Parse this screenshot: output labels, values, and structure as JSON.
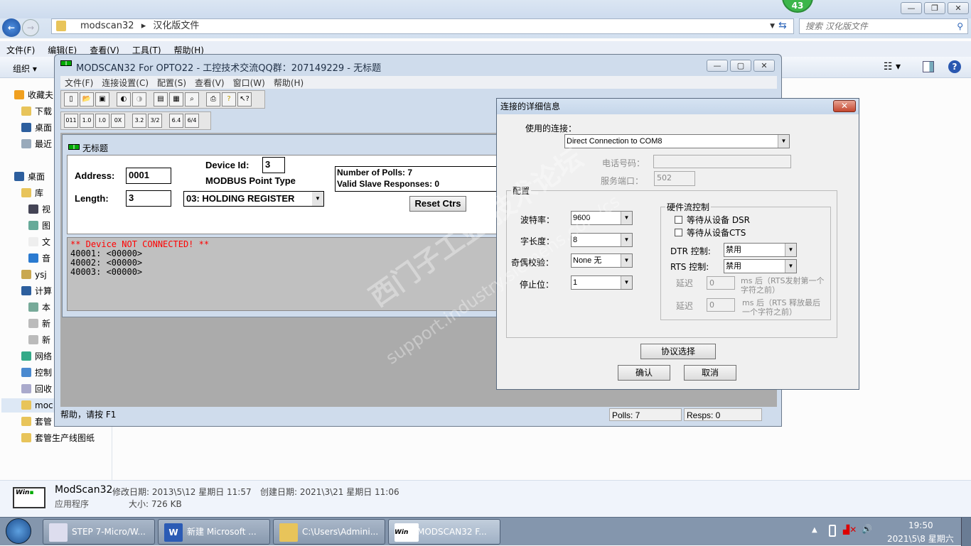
{
  "explorer": {
    "badge": "43",
    "breadcrumb": [
      "modscan32",
      "汉化版文件"
    ],
    "search_placeholder": "搜索 汉化版文件",
    "menu": [
      "文件(F)",
      "编辑(E)",
      "查看(V)",
      "工具(T)",
      "帮助(H)"
    ],
    "organize": "组织 ▾",
    "sidebar": [
      {
        "label": "收藏夫",
        "icon": "star-icon"
      },
      {
        "label": "下载",
        "icon": "download-folder-icon"
      },
      {
        "label": "桌面",
        "icon": "desktop-icon"
      },
      {
        "label": "最近",
        "icon": "recent-icon"
      },
      {
        "label": "桌面",
        "icon": "desktop-icon"
      },
      {
        "label": "库",
        "icon": "library-icon"
      },
      {
        "label": "视",
        "icon": "video-icon"
      },
      {
        "label": "图",
        "icon": "picture-icon"
      },
      {
        "label": "文",
        "icon": "document-icon"
      },
      {
        "label": "音",
        "icon": "music-icon"
      },
      {
        "label": "ysj",
        "icon": "user-folder-icon"
      },
      {
        "label": "计算",
        "icon": "computer-icon"
      },
      {
        "label": "本",
        "icon": "local-disk-icon"
      },
      {
        "label": "新",
        "icon": "drive-icon"
      },
      {
        "label": "新",
        "icon": "drive-icon"
      },
      {
        "label": "网络",
        "icon": "network-icon"
      },
      {
        "label": "控制",
        "icon": "control-panel-icon"
      },
      {
        "label": "回收",
        "icon": "recycle-bin-icon"
      },
      {
        "label": "moc",
        "icon": "folder-icon"
      },
      {
        "label": "套管",
        "icon": "folder-icon"
      },
      {
        "label": "套管生产线图纸",
        "icon": "folder-icon"
      }
    ],
    "details": {
      "name": "ModScan32",
      "modified": "修改日期: 2013\\5\\12 星期日 11:57",
      "created": "创建日期: 2021\\3\\21 星期日 11:06",
      "type": "应用程序",
      "size": "大小: 726 KB"
    }
  },
  "modscan": {
    "title": "MODSCAN32 For OPTO22 - 工控技术交流QQ群：207149229 - 无标题",
    "menu": [
      "文件(F)",
      "连接设置(C)",
      "配置(S)",
      "查看(V)",
      "窗口(W)",
      "帮助(H)"
    ],
    "toolbar2": [
      "011",
      "1.0",
      "I.0",
      "0X",
      "3.2",
      "3/2",
      "6.4",
      "6/4"
    ],
    "child_title": "无标题",
    "address_label": "Address:",
    "address": "0001",
    "device_id_label": "Device Id:",
    "device_id": "3",
    "point_type_label": "MODBUS Point Type",
    "length_label": "Length:",
    "length": "3",
    "point_type": "03: HOLDING REGISTER",
    "polls_text": "Number of Polls: 7",
    "responses_text": "Valid Slave Responses: 0",
    "reset_button": "Reset Ctrs",
    "output": {
      "error": "** Device NOT CONNECTED! **",
      "lines": [
        "40001: <00000>",
        "40002: <00000>",
        "40003: <00000>"
      ]
    },
    "status": {
      "help": "帮助，请按 F1",
      "polls": "Polls: 7",
      "resps": "Resps: 0"
    }
  },
  "dialog": {
    "title": "连接的详细信息",
    "connection_label": "使用的连接：",
    "connection": "Direct Connection to COM8",
    "phone_label": "电话号码：",
    "phone": "",
    "port_label": "服务端口：",
    "port": "502",
    "config_group": "配置",
    "baud_label": "波特率：",
    "baud": "9600",
    "wordlen_label": "字长度：",
    "wordlen": "8",
    "parity_label": "奇偶校验：",
    "parity": "None 无",
    "stopbits_label": "停止位：",
    "stopbits": "1",
    "flow_group": "硬件流控制",
    "dsr_label": "等待从设备 DSR",
    "dsr_checked": false,
    "cts_label": "等待从设备CTS",
    "cts_checked": false,
    "dtr_label": "DTR 控制:",
    "dtr": "禁用",
    "rts_label": "RTS 控制:",
    "rts": "禁用",
    "delay1_label": "延迟",
    "delay1": "0",
    "delay1_note": "ms 后（RTS发射第一个字符之前）",
    "delay2_label": "延迟",
    "delay2": "0",
    "delay2_note": "ms 后（RTS 释放最后一个字符之前）",
    "protocol_button": "协议选择",
    "ok_button": "确认",
    "cancel_button": "取消"
  },
  "taskbar": {
    "items": [
      "STEP 7-Micro/W...",
      "新建 Microsoft ...",
      "C:\\Users\\Admini...",
      "MODSCAN32 F..."
    ],
    "time": "19:50",
    "date": "2021\\5\\8 星期六"
  },
  "watermark": {
    "line1": "西门子工业 技术论坛",
    "line2": "support.industry.siemens.com/cs"
  }
}
